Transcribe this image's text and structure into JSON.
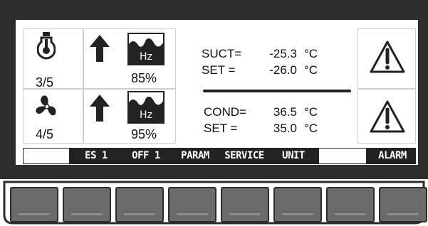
{
  "status_panel": {
    "row1": {
      "fraction": "3/5",
      "percent": "85%"
    },
    "row2": {
      "fraction": "4/5",
      "percent": "95%"
    },
    "hz_label": "Hz"
  },
  "readings": {
    "suction": {
      "name": "SUCT=",
      "value": "-25.3",
      "unit": "°C"
    },
    "suction_set": {
      "name": "SET =",
      "value": "-26.0",
      "unit": "°C"
    },
    "condensing": {
      "name": "COND=",
      "value": "36.5",
      "unit": "°C"
    },
    "condensing_set": {
      "name": "SET =",
      "value": "35.0",
      "unit": "°C"
    }
  },
  "softkeys": [
    {
      "label": ""
    },
    {
      "label": "ES 1"
    },
    {
      "label": "OFF 1"
    },
    {
      "label": "PARAM"
    },
    {
      "label": "SERVICE"
    },
    {
      "label": "UNIT"
    },
    {
      "label": ""
    },
    {
      "label": "ALARM"
    }
  ],
  "icons": {
    "row1_status": "thermometer-bulb-icon",
    "row2_status": "fan-icon",
    "trend": "arrow-up-icon",
    "frequency": "hz-icon",
    "alarm": "warning-triangle-icon"
  }
}
